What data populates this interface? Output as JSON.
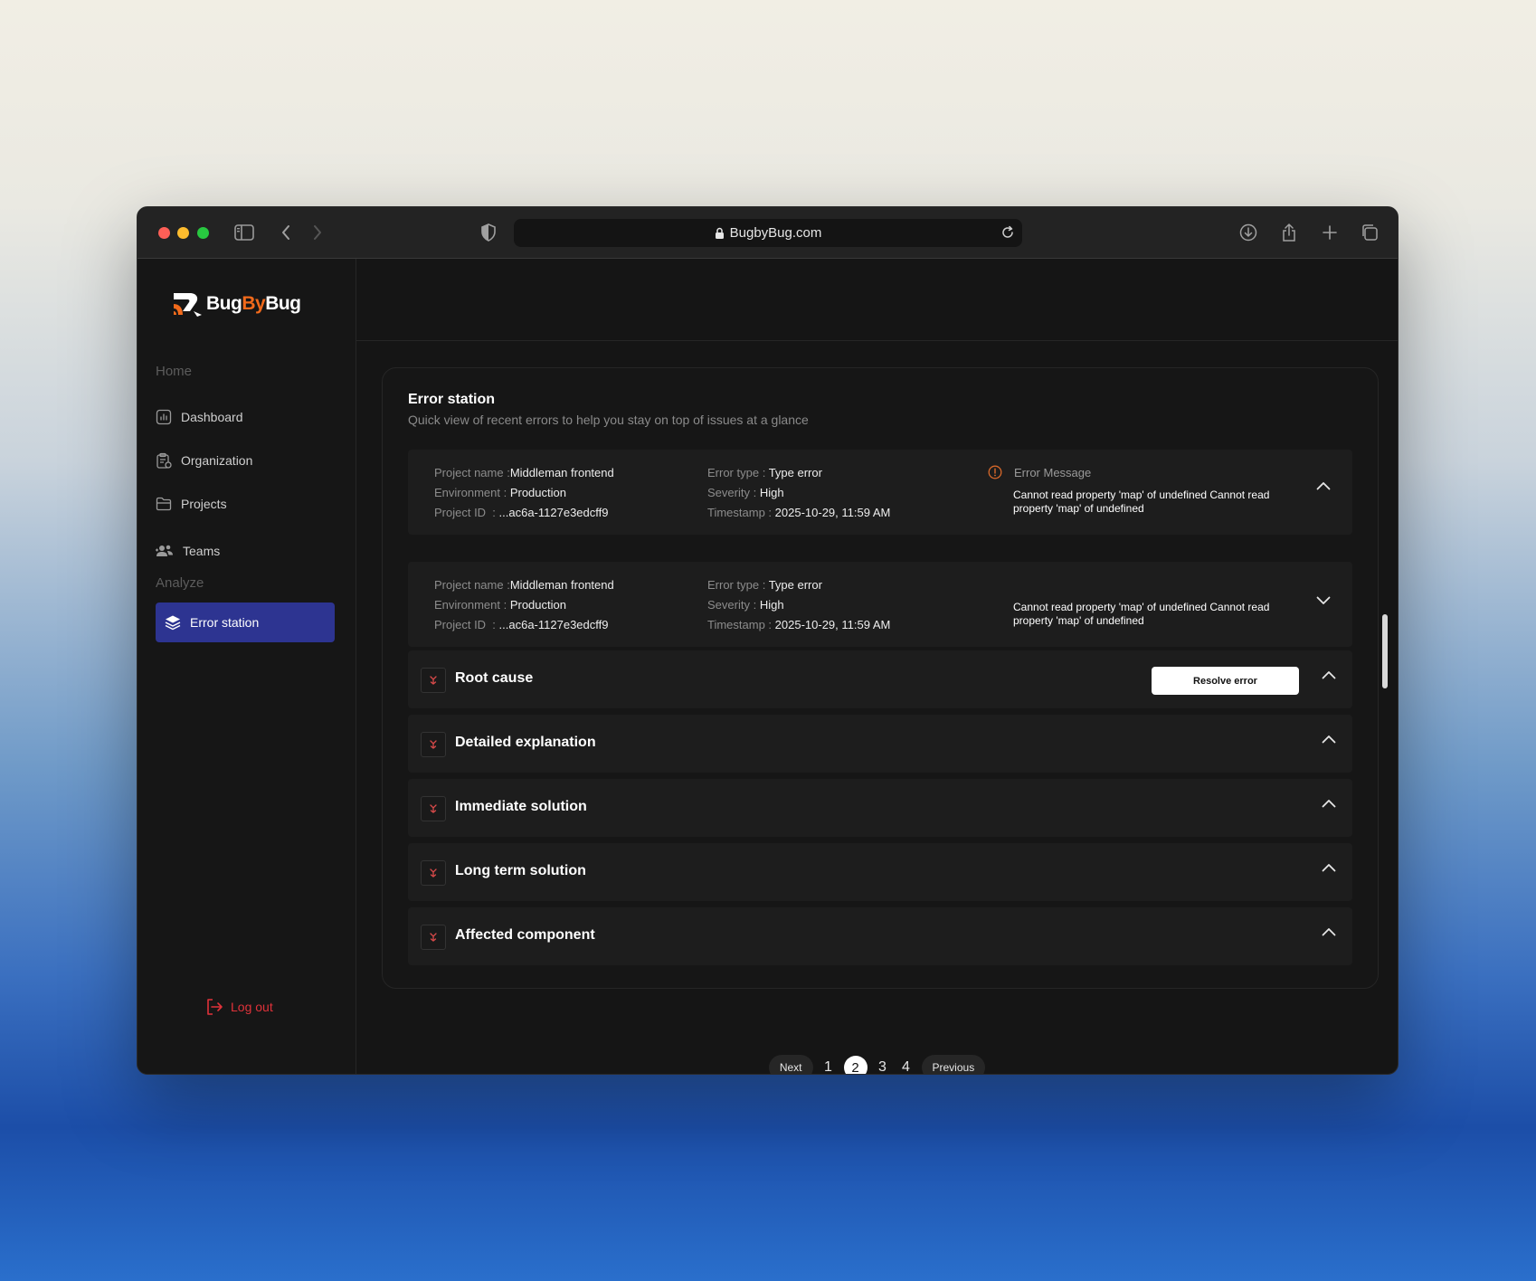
{
  "browser": {
    "url": "BugbyBug.com"
  },
  "brand": {
    "name_part1": "Bug",
    "name_part2": "By",
    "name_part3": "Bug",
    "accent_color": "#f26a1b"
  },
  "sidebar": {
    "section_home": "Home",
    "section_analyze": "Analyze",
    "items": [
      {
        "label": "Dashboard",
        "icon": "chart-icon"
      },
      {
        "label": "Organization",
        "icon": "clipboard-icon"
      },
      {
        "label": "Projects",
        "icon": "folder-icon"
      },
      {
        "label": "Teams",
        "icon": "users-icon"
      }
    ],
    "active_item": {
      "label": "Error station",
      "icon": "layers-icon",
      "color": "#2d3491"
    },
    "logout_label": "Log out",
    "logout_color": "#e0323a"
  },
  "card": {
    "title": "Error station",
    "subtitle": "Quick view of recent errors to help you stay on top of issues at a glance"
  },
  "errors": [
    {
      "project_name_label": "Project name",
      "project_name": "Middleman frontend",
      "environment_label": "Environment",
      "environment": "Production",
      "project_id_label": "Project ID",
      "project_id": "...ac6a-1127e3edcff9",
      "error_type_label": "Error type",
      "error_type": "Type error",
      "severity_label": "Severity",
      "severity": "High",
      "timestamp_label": "Timestamp",
      "timestamp": "2025-10-29, 11:59 AM",
      "message_label": "Error Message",
      "message": "Cannot read property 'map' of undefined Cannot read property 'map' of undefined"
    },
    {
      "project_name_label": "Project name",
      "project_name": "Middleman frontend",
      "environment_label": "Environment",
      "environment": "Production",
      "project_id_label": "Project ID",
      "project_id": "...ac6a-1127e3edcff9",
      "error_type_label": "Error type",
      "error_type": "Type error",
      "severity_label": "Severity",
      "severity": "High",
      "timestamp_label": "Timestamp",
      "timestamp": "2025-10-29, 11:59 AM",
      "message": "Cannot read property 'map' of undefined Cannot read property 'map' of undefined"
    }
  ],
  "details": {
    "resolve_label": "Resolve error",
    "sections": [
      "Root cause",
      "Detailed explanation",
      "Immediate solution",
      "Long term solution",
      "Affected component"
    ]
  },
  "pagination": {
    "next_label": "Next",
    "previous_label": "Previous",
    "pages": [
      "1",
      "2",
      "3",
      "4"
    ],
    "current": "2"
  }
}
